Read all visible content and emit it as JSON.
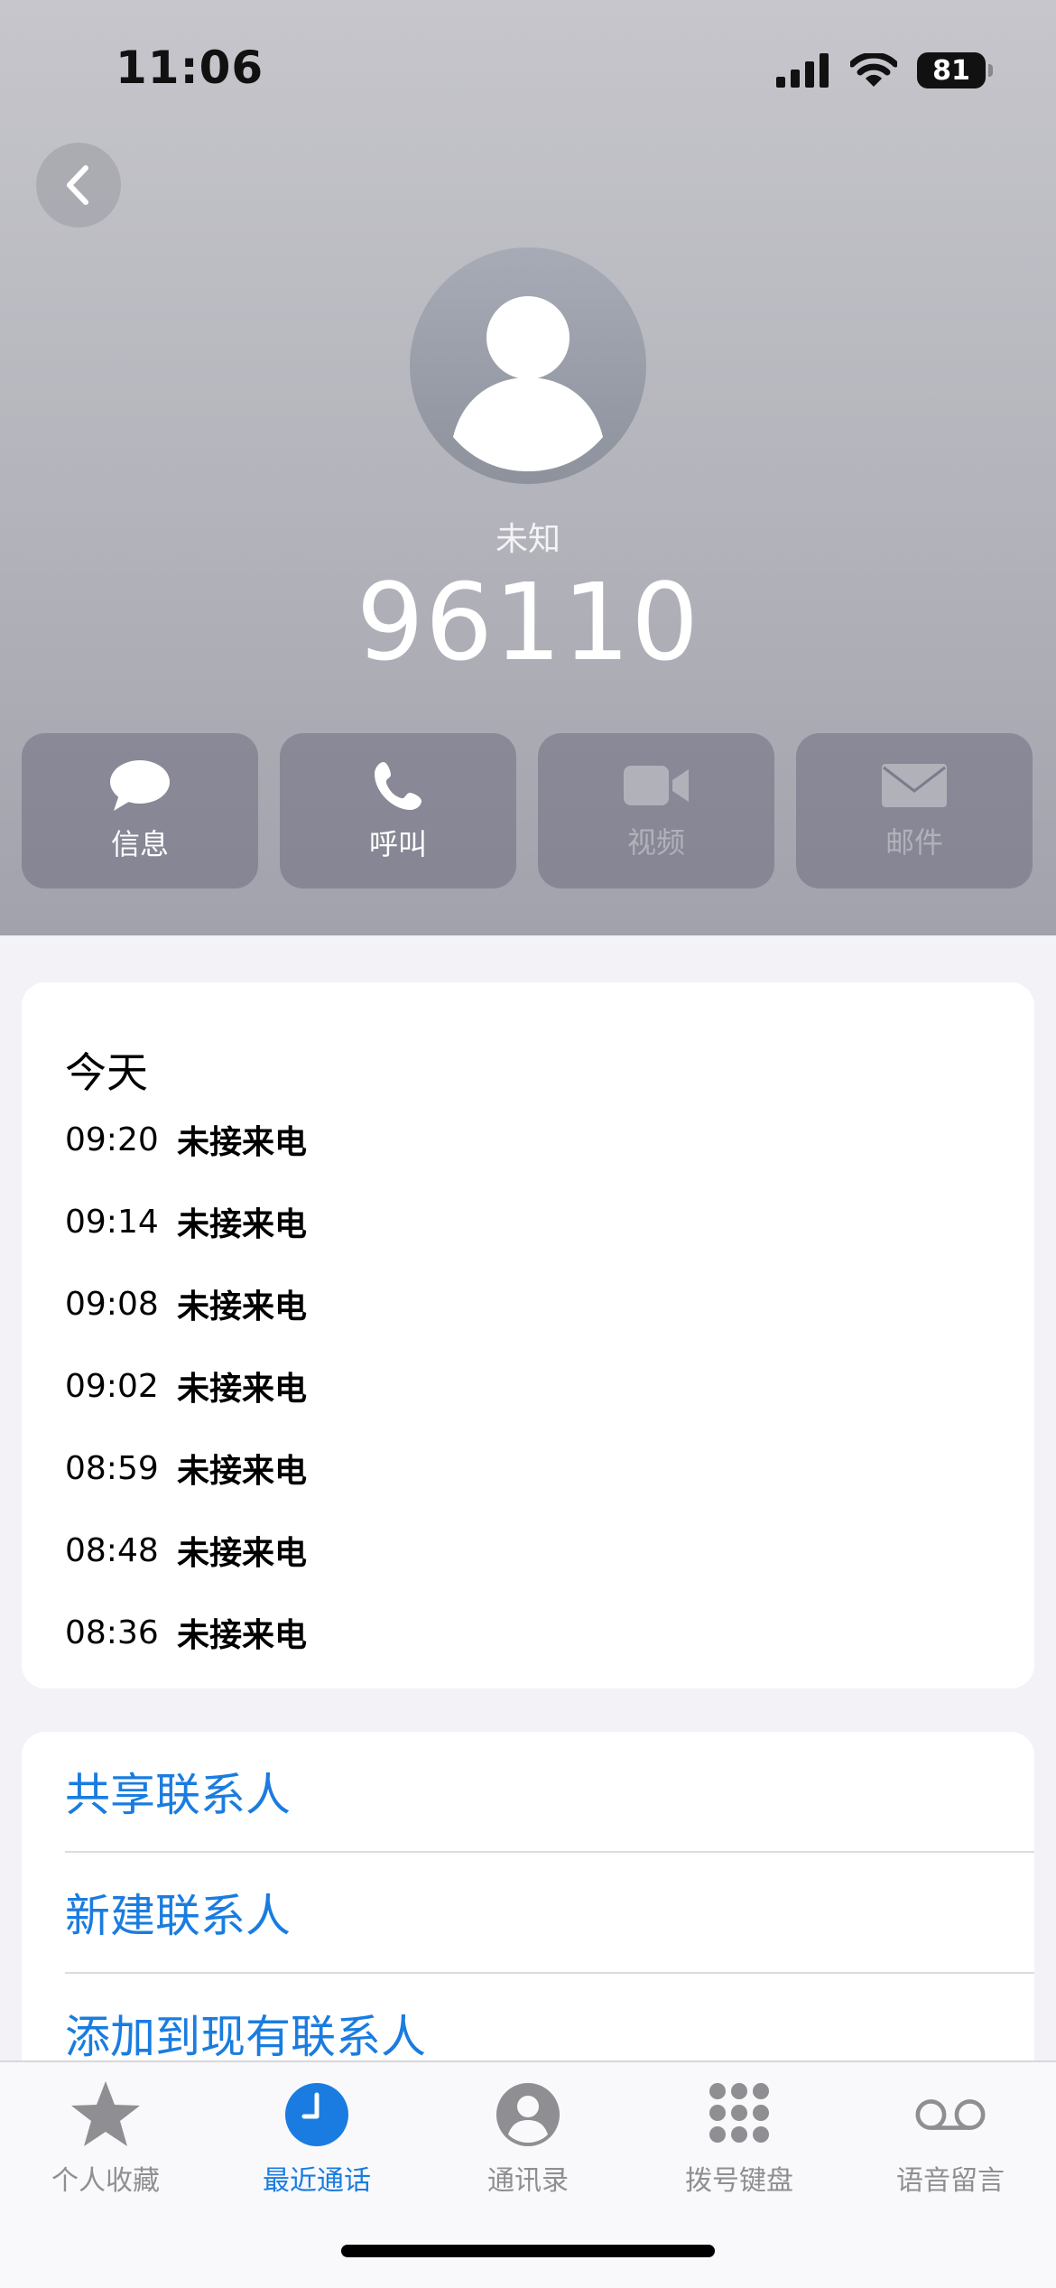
{
  "status_bar": {
    "time": "11:06",
    "battery": "81"
  },
  "contact": {
    "label": "未知",
    "number": "96110"
  },
  "actions": [
    {
      "label": "信息",
      "icon": "message-icon",
      "enabled": true
    },
    {
      "label": "呼叫",
      "icon": "phone-icon",
      "enabled": true
    },
    {
      "label": "视频",
      "icon": "video-icon",
      "enabled": false
    },
    {
      "label": "邮件",
      "icon": "mail-icon",
      "enabled": false
    }
  ],
  "recents": {
    "day": "今天",
    "calls": [
      {
        "time": "09:20",
        "type": "未接来电"
      },
      {
        "time": "09:14",
        "type": "未接来电"
      },
      {
        "time": "09:08",
        "type": "未接来电"
      },
      {
        "time": "09:02",
        "type": "未接来电"
      },
      {
        "time": "08:59",
        "type": "未接来电"
      },
      {
        "time": "08:48",
        "type": "未接来电"
      },
      {
        "time": "08:36",
        "type": "未接来电"
      }
    ]
  },
  "contact_actions": [
    {
      "label": "共享联系人"
    },
    {
      "label": "新建联系人"
    },
    {
      "label": "添加到现有联系人"
    }
  ],
  "tabs": [
    {
      "label": "个人收藏",
      "icon": "star-icon"
    },
    {
      "label": "最近通话",
      "icon": "clock-icon",
      "active": true
    },
    {
      "label": "通讯录",
      "icon": "person-circle-icon"
    },
    {
      "label": "拨号键盘",
      "icon": "keypad-icon"
    },
    {
      "label": "语音留言",
      "icon": "voicemail-icon"
    }
  ],
  "colors": {
    "accent": "#1a7ce0",
    "inactive_tab": "#8e8e93"
  }
}
